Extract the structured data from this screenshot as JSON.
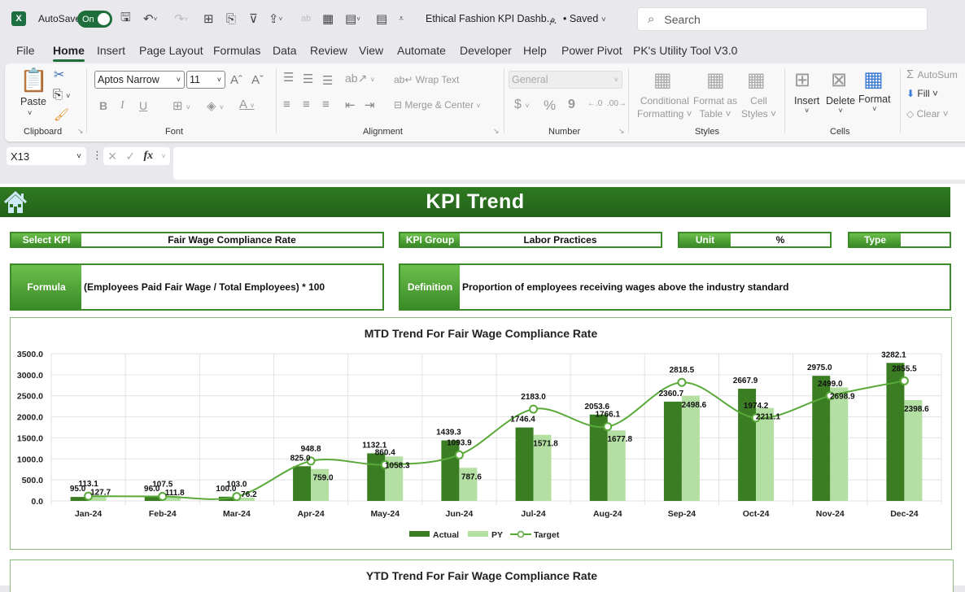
{
  "titlebar": {
    "app_icon": "excel-icon",
    "autosave_label": "AutoSave",
    "autosave_state": "On",
    "document_title": "Ethical Fashion KPI Dashb...",
    "save_status": "• Saved",
    "search_placeholder": "Search"
  },
  "tabs": [
    {
      "label": "File"
    },
    {
      "label": "Home",
      "active": true
    },
    {
      "label": "Insert"
    },
    {
      "label": "Page Layout"
    },
    {
      "label": "Formulas"
    },
    {
      "label": "Data"
    },
    {
      "label": "Review"
    },
    {
      "label": "View"
    },
    {
      "label": "Automate"
    },
    {
      "label": "Developer"
    },
    {
      "label": "Help"
    },
    {
      "label": "Power Pivot"
    },
    {
      "label": "PK's Utility Tool V3.0"
    }
  ],
  "ribbon": {
    "clipboard": {
      "label": "Clipboard",
      "paste": "Paste"
    },
    "font": {
      "label": "Font",
      "font_name": "Aptos Narrow",
      "font_size": "11",
      "bold": "B",
      "italic": "I",
      "underline": "U"
    },
    "alignment": {
      "label": "Alignment",
      "wrap_text": "Wrap Text",
      "merge_center": "Merge & Center"
    },
    "number": {
      "label": "Number",
      "format": "General",
      "currency": "$",
      "percent": "%",
      "comma": "9"
    },
    "styles": {
      "label": "Styles",
      "conditional_formatting": [
        "Conditional",
        "Formatting ˅"
      ],
      "format_as_table": [
        "Format as",
        "Table ˅"
      ],
      "cell_styles": [
        "Cell",
        "Styles ˅"
      ]
    },
    "cells": {
      "label": "Cells",
      "insert": "Insert",
      "delete": "Delete",
      "format": "Format"
    },
    "editing": {
      "autosum": "AutoSum",
      "fill": "Fill ˅",
      "clear": "Clear ˅"
    }
  },
  "formula_bar": {
    "name_box": "X13",
    "formula": ""
  },
  "dashboard": {
    "title": "KPI Trend",
    "select_kpi": {
      "label": "Select KPI",
      "value": "Fair Wage Compliance Rate"
    },
    "kpi_group": {
      "label": "KPI Group",
      "value": "Labor Practices"
    },
    "unit": {
      "label": "Unit",
      "value": "%"
    },
    "type": {
      "label": "Type",
      "value": ""
    },
    "formula": {
      "label": "Formula",
      "value": "(Employees Paid Fair Wage / Total Employees) * 100"
    },
    "definition": {
      "label": "Definition",
      "value": "Proportion of employees receiving wages above the industry standard"
    },
    "ytd_title": "YTD Trend For Fair Wage Compliance Rate"
  },
  "colors": {
    "actual": "#3b7d23",
    "py": "#b3e0a2",
    "target": "#5aaa3a",
    "banner": "#2a6e1e"
  },
  "chart_data": {
    "type": "bar",
    "title": "MTD Trend For Fair Wage Compliance Rate",
    "xlabel": "",
    "ylabel": "",
    "ylim": [
      0,
      3500
    ],
    "yticks": [
      "0.0",
      "500.0",
      "1000.0",
      "1500.0",
      "2000.0",
      "2500.0",
      "3000.0",
      "3500.0"
    ],
    "grid": true,
    "legend": "bottom",
    "categories": [
      "Jan-24",
      "Feb-24",
      "Mar-24",
      "Apr-24",
      "May-24",
      "Jun-24",
      "Jul-24",
      "Aug-24",
      "Sep-24",
      "Oct-24",
      "Nov-24",
      "Dec-24"
    ],
    "series": [
      {
        "name": "Actual",
        "kind": "bar",
        "values": [
          95.0,
          96.0,
          100.0,
          825.0,
          1132.1,
          1439.3,
          1746.4,
          2053.6,
          2360.7,
          2667.9,
          2975.0,
          3282.1
        ]
      },
      {
        "name": "PY",
        "kind": "bar",
        "values": [
          127.7,
          111.8,
          76.2,
          759.0,
          1058.3,
          787.6,
          1571.8,
          1677.8,
          2498.6,
          2211.1,
          2698.9,
          2398.6
        ]
      },
      {
        "name": "Target",
        "kind": "line",
        "values": [
          113.1,
          107.5,
          103.0,
          948.8,
          860.4,
          1093.9,
          2183.0,
          1766.1,
          2818.5,
          1974.2,
          2499.0,
          2855.5
        ]
      }
    ]
  }
}
